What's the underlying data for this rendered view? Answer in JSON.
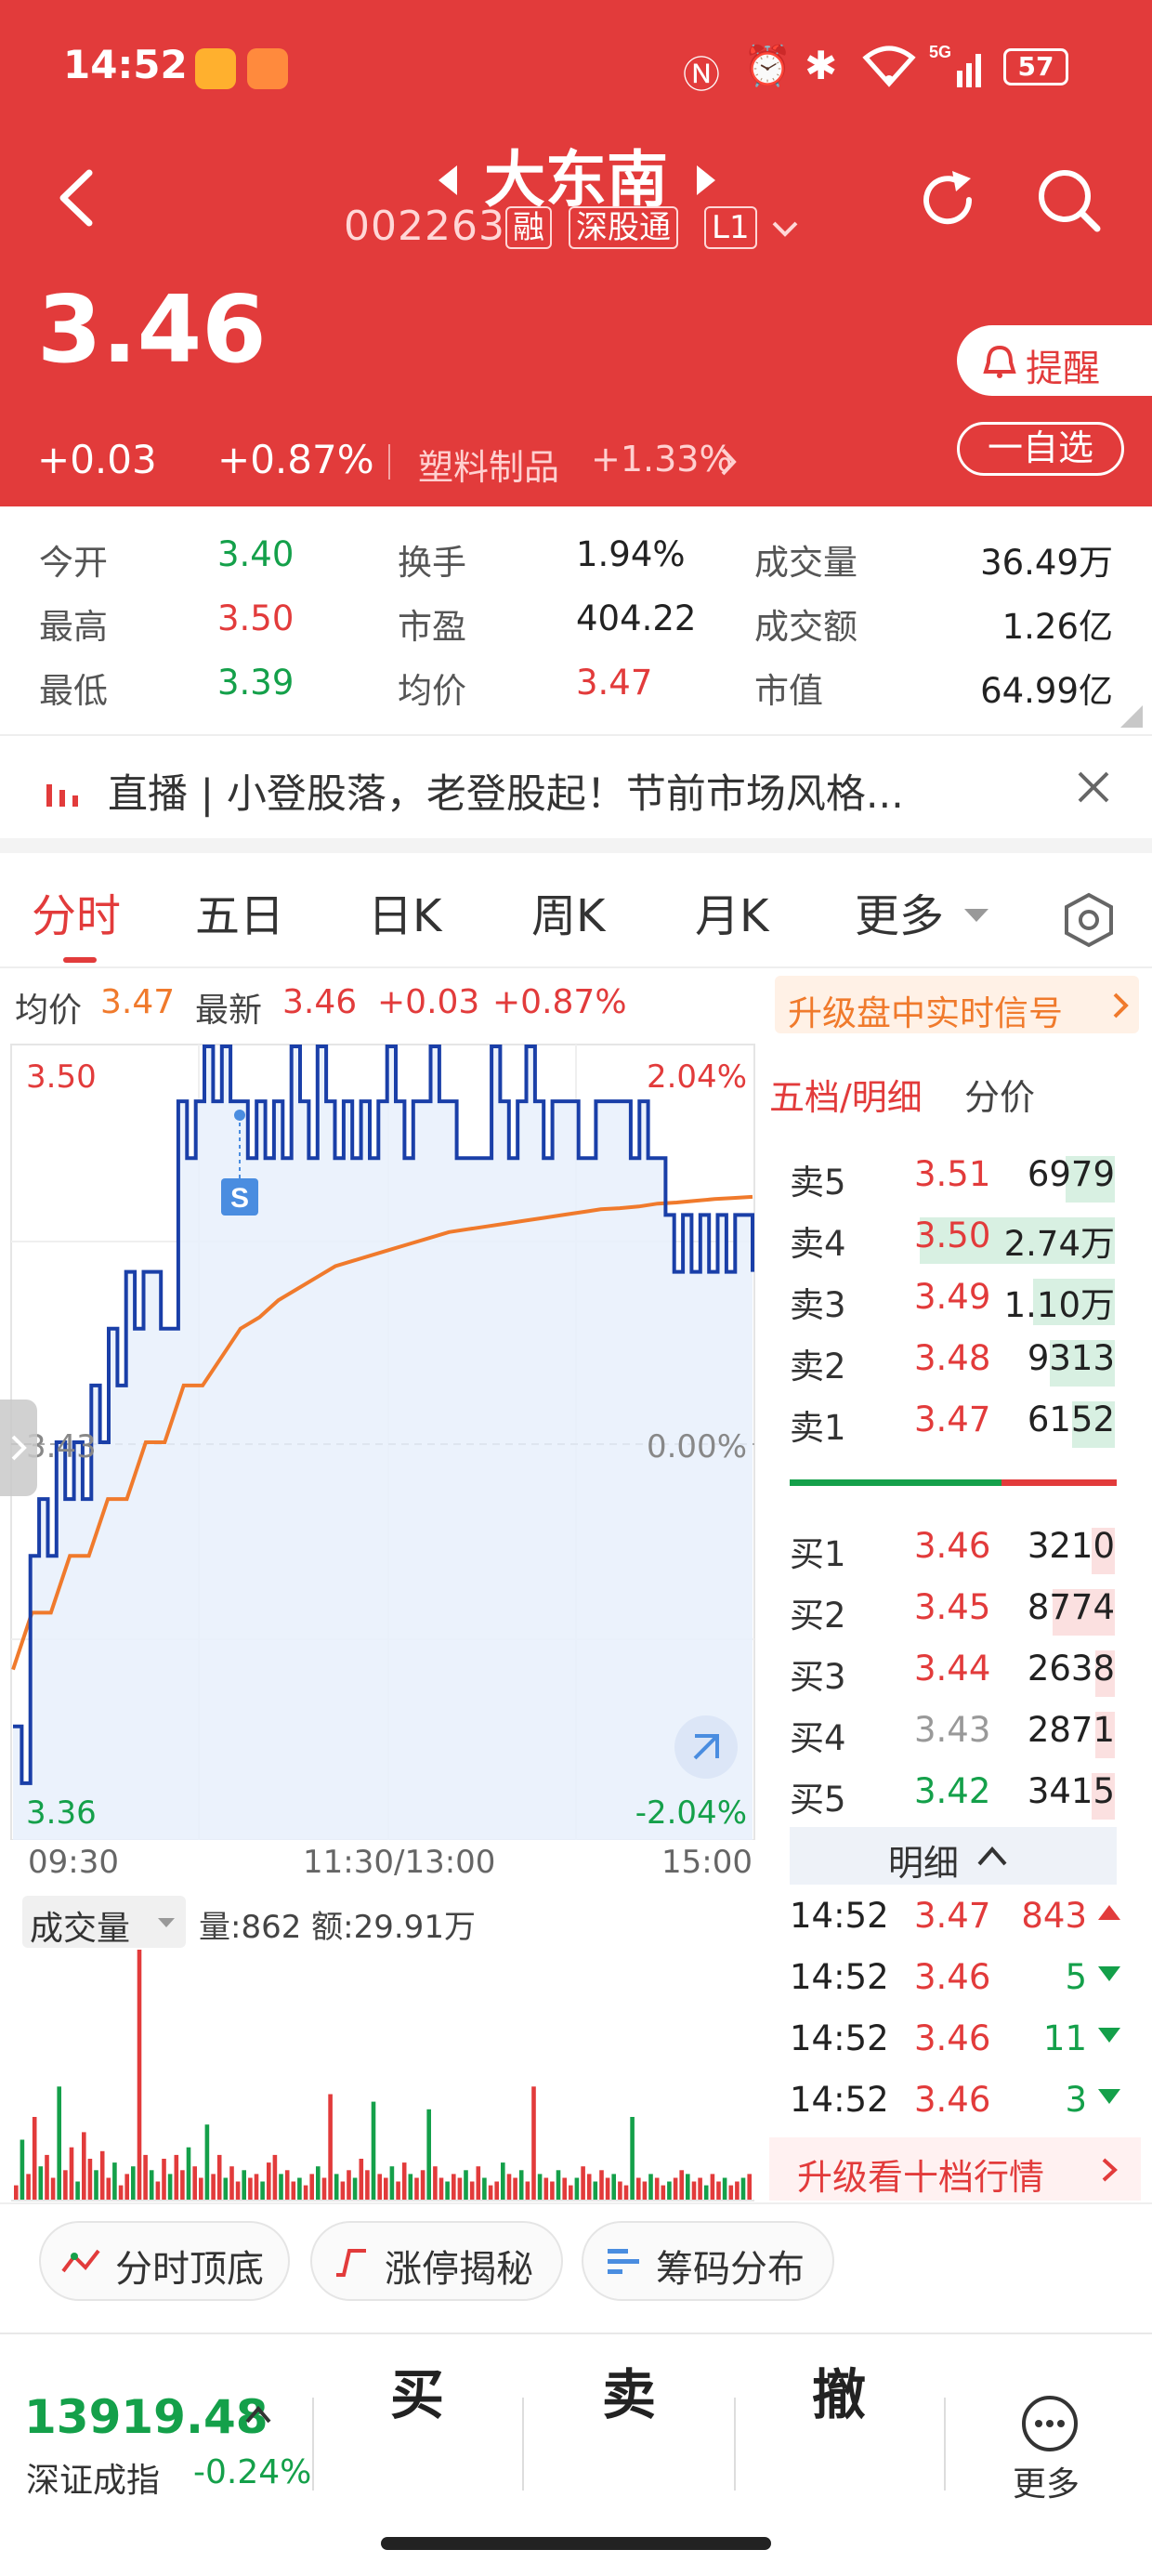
{
  "status_bar": {
    "time": "14:52",
    "battery": "57"
  },
  "header": {
    "stock_name": "大东南",
    "stock_code": "002263",
    "tags": [
      "融",
      "深股通",
      "L1"
    ],
    "price": "3.46",
    "change": "+0.03",
    "change_pct": "+0.87%",
    "sector": "塑料制品",
    "sector_change": "+1.33%",
    "alert_label": "提醒",
    "watch_label": "一自选"
  },
  "stats": [
    {
      "label": "今开",
      "value": "3.40",
      "color": "#14a04a"
    },
    {
      "label": "换手",
      "value": "1.94%",
      "color": "#222222"
    },
    {
      "label": "成交量",
      "value": "36.49万",
      "color": "#222222"
    },
    {
      "label": "最高",
      "value": "3.50",
      "color": "#e23b3b"
    },
    {
      "label": "市盈",
      "value": "404.22",
      "color": "#222222"
    },
    {
      "label": "成交额",
      "value": "1.26亿",
      "color": "#222222"
    },
    {
      "label": "最低",
      "value": "3.39",
      "color": "#14a04a"
    },
    {
      "label": "均价",
      "value": "3.47",
      "color": "#e23b3b"
    },
    {
      "label": "市值",
      "value": "64.99亿",
      "color": "#222222"
    }
  ],
  "live_banner": {
    "text": "直播 | 小登股落，老登股起！节前市场风格..."
  },
  "tabs": [
    "分时",
    "五日",
    "日K",
    "周K",
    "月K",
    "更多"
  ],
  "info_line": {
    "avg_label": "均价",
    "avg_value": "3.47",
    "latest_label": "最新",
    "latest_value": "3.46",
    "change": "+0.03",
    "change_pct": "+0.87%",
    "upgrade_label": "升级盘中实时信号"
  },
  "chart_labels": {
    "y_top": "3.50",
    "y_mid": "3.43",
    "y_bottom": "3.36",
    "pct_top": "2.04%",
    "pct_mid": "0.00%",
    "pct_bottom": "-2.04%",
    "marker": "S",
    "volume_selector": "成交量",
    "volume_info": "量:862 额:29.91万"
  },
  "chart_data": [
    {
      "type": "line",
      "title": "分时",
      "x_ticks": [
        "09:30",
        "11:30/13:00",
        "15:00"
      ],
      "ylim": [
        3.36,
        3.5
      ],
      "series": [
        {
          "name": "价格",
          "color": "#1a3fa8",
          "values": [
            3.38,
            3.37,
            3.41,
            3.42,
            3.41,
            3.43,
            3.42,
            3.43,
            3.42,
            3.44,
            3.43,
            3.45,
            3.44,
            3.46,
            3.45,
            3.46,
            3.46,
            3.45,
            3.45,
            3.49,
            3.48,
            3.49,
            3.5,
            3.49,
            3.5,
            3.49,
            3.49,
            3.48,
            3.49,
            3.48,
            3.49,
            3.48,
            3.5,
            3.49,
            3.48,
            3.5,
            3.49,
            3.48,
            3.49,
            3.48,
            3.49,
            3.48,
            3.49,
            3.5,
            3.49,
            3.48,
            3.49,
            3.49,
            3.5,
            3.49,
            3.49,
            3.48,
            3.48,
            3.48,
            3.48,
            3.5,
            3.49,
            3.48,
            3.49,
            3.5,
            3.49,
            3.48,
            3.49,
            3.49,
            3.49,
            3.48,
            3.48,
            3.49,
            3.49,
            3.49,
            3.49,
            3.48,
            3.49,
            3.48,
            3.48,
            3.47,
            3.46,
            3.47,
            3.46,
            3.47,
            3.46,
            3.47,
            3.46,
            3.47,
            3.47,
            3.46
          ]
        },
        {
          "name": "均价",
          "color": "#f07a2c",
          "values": [
            3.39,
            3.4,
            3.4,
            3.41,
            3.41,
            3.42,
            3.42,
            3.43,
            3.43,
            3.44,
            3.44,
            3.445,
            3.45,
            3.452,
            3.455,
            3.457,
            3.459,
            3.461,
            3.462,
            3.463,
            3.464,
            3.465,
            3.466,
            3.467,
            3.4675,
            3.468,
            3.4685,
            3.469,
            3.4695,
            3.47,
            3.4705,
            3.471,
            3.4712,
            3.4715,
            3.472,
            3.4722,
            3.4725,
            3.4728,
            3.473,
            3.4732
          ]
        }
      ]
    },
    {
      "type": "bar",
      "title": "成交量",
      "values": [
        20,
        80,
        35,
        110,
        45,
        60,
        30,
        150,
        40,
        70,
        25,
        90,
        55,
        40,
        65,
        30,
        50,
        20,
        35,
        45,
        330,
        60,
        40,
        25,
        55,
        35,
        60,
        40,
        70,
        45,
        30,
        100,
        35,
        60,
        30,
        45,
        25,
        40,
        30,
        35,
        25,
        50,
        60,
        35,
        40,
        25,
        30,
        20,
        35,
        45,
        30,
        140,
        35,
        25,
        40,
        30,
        55,
        40,
        130,
        35,
        30,
        45,
        25,
        50,
        35,
        30,
        40,
        120,
        45,
        30,
        25,
        35,
        30,
        40,
        25,
        45,
        30,
        20,
        25,
        50,
        35,
        30,
        40,
        25,
        150,
        35,
        30,
        25,
        40,
        30,
        20,
        30,
        45,
        35,
        25,
        40,
        30,
        35,
        25,
        20,
        110,
        30,
        25,
        35,
        30,
        20,
        25,
        30,
        40,
        35,
        25,
        30,
        20,
        35,
        25,
        30,
        20,
        25,
        30,
        35
      ]
    }
  ],
  "order_book": {
    "header": "五档/明细",
    "price_header": "分价",
    "asks": [
      {
        "label": "卖5",
        "price": "3.51",
        "vol": "6979"
      },
      {
        "label": "卖4",
        "price": "3.50",
        "vol": "2.74万"
      },
      {
        "label": "卖3",
        "price": "3.49",
        "vol": "1.10万"
      },
      {
        "label": "卖2",
        "price": "3.48",
        "vol": "9313"
      },
      {
        "label": "卖1",
        "price": "3.47",
        "vol": "6152"
      }
    ],
    "bids": [
      {
        "label": "买1",
        "price": "3.46",
        "vol": "3210"
      },
      {
        "label": "买2",
        "price": "3.45",
        "vol": "8774"
      },
      {
        "label": "买3",
        "price": "3.44",
        "vol": "2638"
      },
      {
        "label": "买4",
        "price": "3.43",
        "vol": "2871"
      },
      {
        "label": "买5",
        "price": "3.42",
        "vol": "3415"
      }
    ],
    "ask_depth": [
      0.15,
      0.6,
      0.25,
      0.2,
      0.13
    ],
    "bid_depth": [
      0.07,
      0.19,
      0.06,
      0.06,
      0.07
    ],
    "detail_label": "明细",
    "ticks": [
      {
        "time": "14:52",
        "price": "3.47",
        "vol": "843",
        "dir": "up"
      },
      {
        "time": "14:52",
        "price": "3.46",
        "vol": "5",
        "dir": "down"
      },
      {
        "time": "14:52",
        "price": "3.46",
        "vol": "11",
        "dir": "down"
      },
      {
        "time": "14:52",
        "price": "3.46",
        "vol": "3",
        "dir": "down"
      }
    ],
    "upgrade_label": "升级看十档行情"
  },
  "tools": [
    {
      "label": "分时顶底"
    },
    {
      "label": "涨停揭秘"
    },
    {
      "label": "筹码分布"
    }
  ],
  "footer": {
    "index_value": "13919.48",
    "index_name": "深证成指",
    "index_change": "-0.24%",
    "buy": "买",
    "sell": "卖",
    "cancel": "撤",
    "more": "更多"
  }
}
